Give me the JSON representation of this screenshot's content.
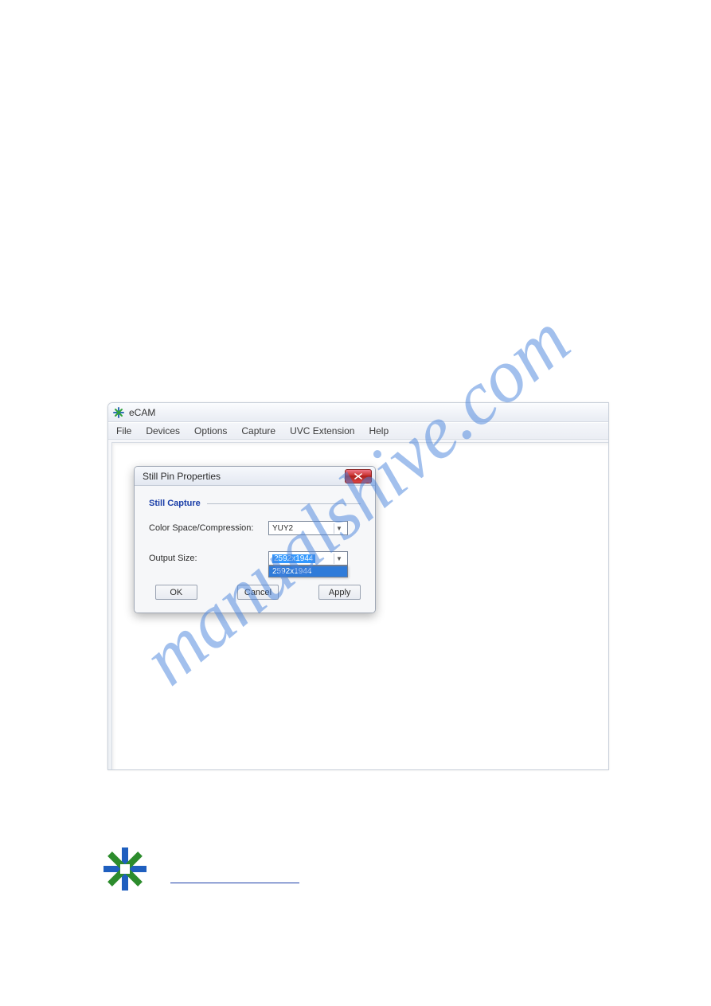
{
  "watermark": "manualshive.com",
  "ecam": {
    "title": "eCAM",
    "menus": [
      "File",
      "Devices",
      "Options",
      "Capture",
      "UVC Extension",
      "Help"
    ]
  },
  "dialog": {
    "title": "Still Pin Properties",
    "group_title": "Still Capture",
    "rows": {
      "color_space_label": "Color Space/Compression:",
      "color_space_value": "YUY2",
      "output_size_label": "Output Size:",
      "output_size_value": "2592x1944",
      "output_size_option": "2592x1944"
    },
    "buttons": {
      "ok": "OK",
      "cancel": "Cancel",
      "apply": "Apply"
    }
  }
}
